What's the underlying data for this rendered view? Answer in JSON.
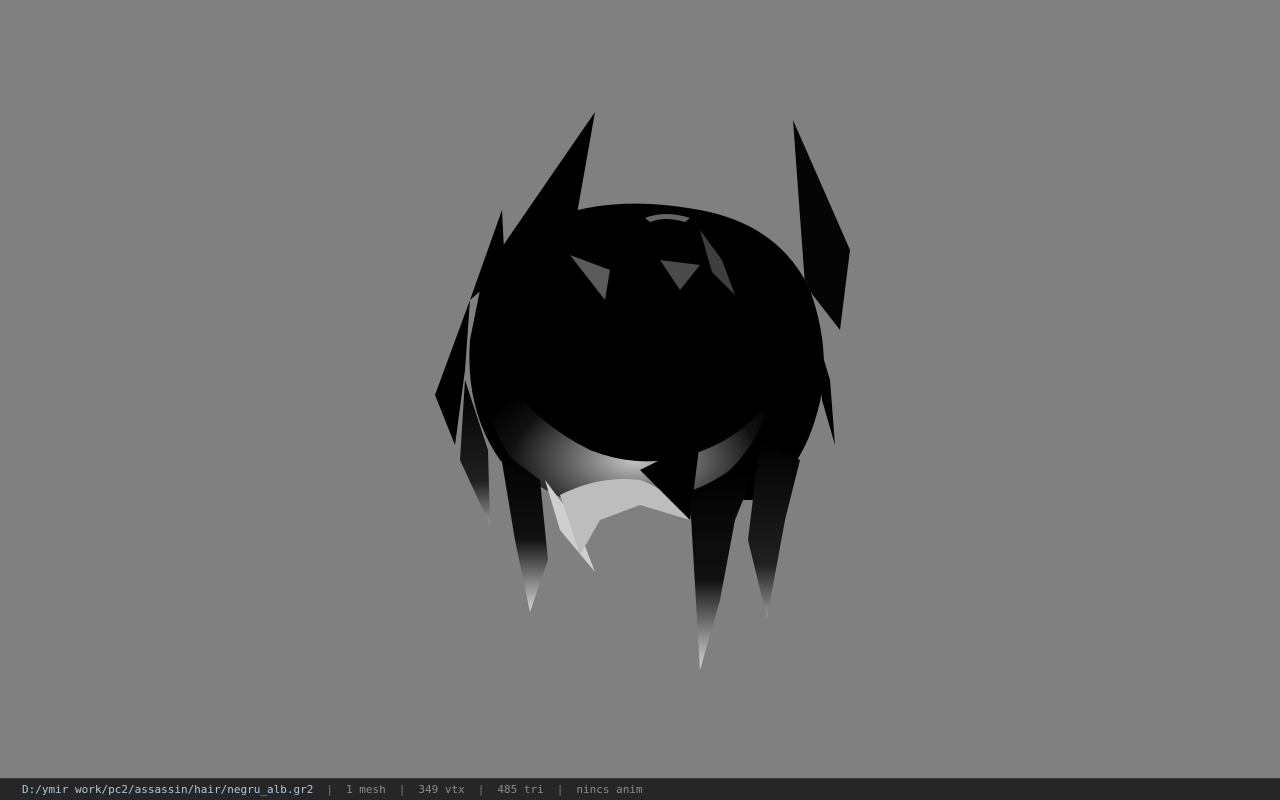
{
  "status_bar": {
    "file_path": "D:/ymir work/pc2/assassin/hair/negru_alb.gr2",
    "separator": "|",
    "mesh_count": "1 mesh",
    "vertex_count": "349 vtx",
    "triangle_count": "485 tri",
    "animation_status": "nincs anim"
  },
  "colors": {
    "viewport_background": "#808080",
    "status_bar_background": "#262626",
    "path_text": "#a9c7dc",
    "info_text": "#8a8a8a"
  }
}
